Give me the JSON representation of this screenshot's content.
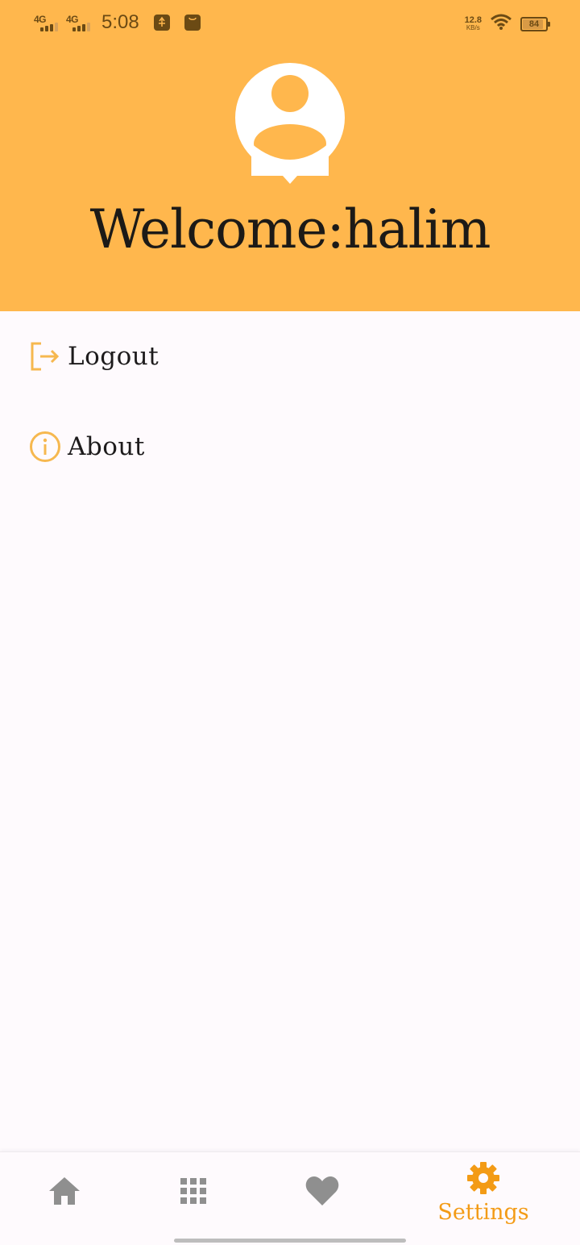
{
  "status_bar": {
    "network1": "4G",
    "network2": "4G",
    "time": "5:08",
    "speed_value": "12.8",
    "speed_unit": "KB/s",
    "battery": "84"
  },
  "header": {
    "welcome_text": "Welcome:halim",
    "avatar_icon": "account-circle-icon"
  },
  "menu": {
    "items": [
      {
        "label": "Logout",
        "icon": "logout-icon"
      },
      {
        "label": "About",
        "icon": "info-icon"
      }
    ]
  },
  "bottom_nav": {
    "items": [
      {
        "icon": "home-icon",
        "label": ""
      },
      {
        "icon": "apps-icon",
        "label": ""
      },
      {
        "icon": "heart-icon",
        "label": ""
      },
      {
        "icon": "settings-icon",
        "label": "Settings",
        "active": true
      }
    ]
  },
  "colors": {
    "primary": "#ffb74d",
    "accent": "#f39b16",
    "icon_inactive": "#8f8f8f",
    "background": "#fefafd"
  }
}
